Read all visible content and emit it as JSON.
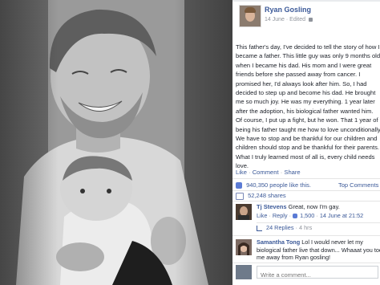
{
  "post": {
    "author": "Ryan Gosling",
    "date": "14 June",
    "edited": "Edited",
    "lines": [
      "This father's day, I've decided to tell the story of how I",
      "became a father. This little guy was only 9 months old",
      "when I became his dad. His mom and I were great",
      "friends before she passed away from cancer. I",
      "promised her, I'd always look after him. So, I had",
      "decided to step up and become his dad. He brought",
      "me so much joy. He was my everything. 1 year later",
      "after the adoption, his biological father wanted him.",
      "Of course, I put up a fight, but he won. That 1 year of",
      "being his father taught me how to love unconditionally",
      "We have to stop and be thankful for our children and",
      "children should stop and be thankful for their parents.",
      "What I truly learned most of all is, every child needs",
      "love."
    ],
    "actions": {
      "like": "Like",
      "comment": "Comment",
      "share": "Share"
    },
    "likes_text": "940,350 people like this.",
    "top_comments_label": "Top Comments",
    "shares_text": "52,248 shares"
  },
  "comments": [
    {
      "name": "Tj Stevens",
      "text": "Great, now I'm gay.",
      "like": "Like",
      "reply": "Reply",
      "likes": "1,500",
      "time": "14 June at 21:52",
      "replies": "24 Replies",
      "replies_age": "4 hrs"
    },
    {
      "name": "Samantha Tong",
      "text_lines": [
        "Lol I would never let my",
        "biological father live that down... Whaaat you too",
        "me away from Ryan gosling!"
      ]
    }
  ],
  "comment_input": {
    "placeholder": "Write a comment..."
  },
  "colors": {
    "link": "#3b5998",
    "meta": "#90949c",
    "text": "#1d2129"
  }
}
